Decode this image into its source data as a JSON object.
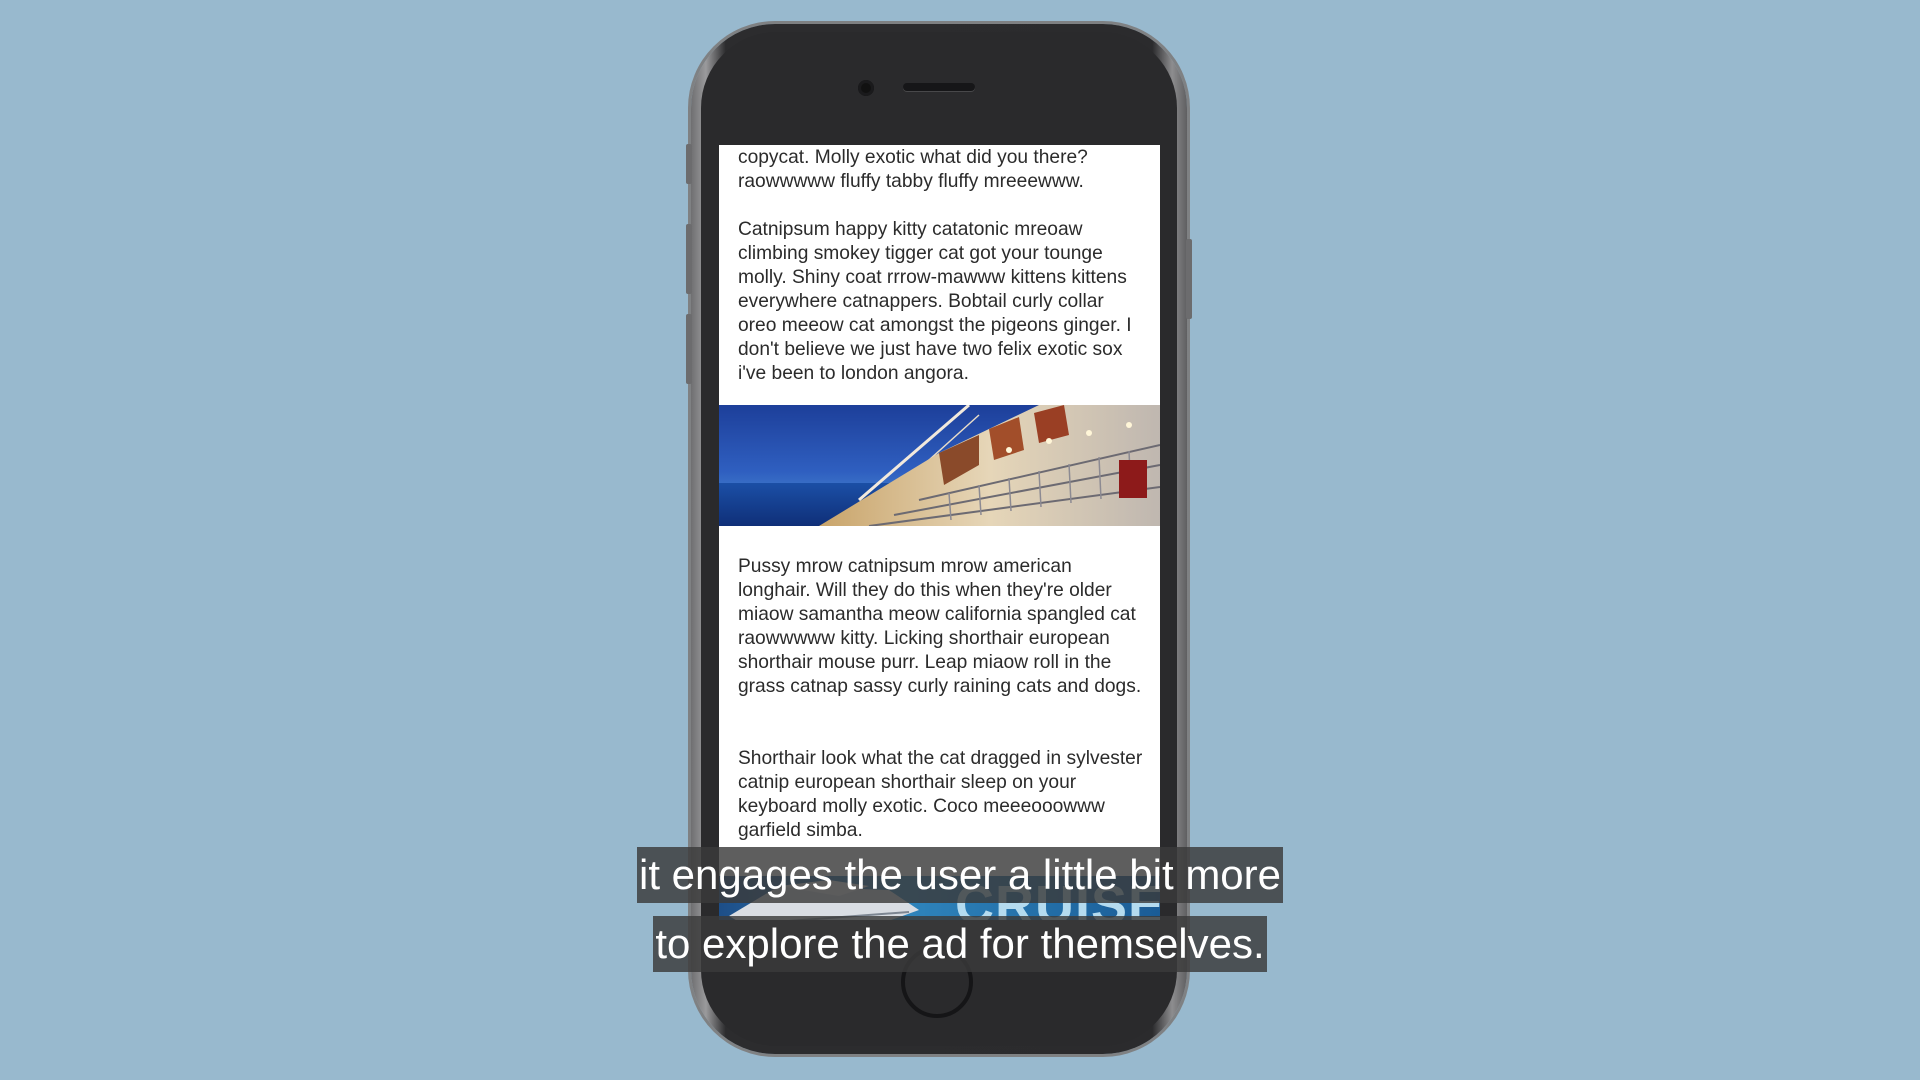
{
  "article": {
    "para_top": "copycat. Molly exotic what did you there? raowwwww fluffy tabby fluffy mreeewww.",
    "para_1": "Catnipsum happy kitty catatonic mreoaw climbing smokey tigger cat got your tounge molly. Shiny coat rrrow-mawww kittens kittens everywhere catnappers. Bobtail curly collar oreo meeow cat amongst the pigeons ginger. I don't believe we just have two felix exotic sox i've been to london angora.",
    "para_2": "Pussy mrow catnipsum mrow american longhair. Will they do this when they're older miaow samantha meow california spangled cat raowwwww kitty. Licking shorthair european shorthair mouse purr. Leap miaow roll in the grass catnap sassy curly raining cats and dogs.",
    "para_3": "Shorthair look what the cat dragged in sylvester catnip european shorthair sleep on your keyboard molly exotic. Coco meeeooowww garfield simba."
  },
  "ad_banner": {
    "label": "CRUISE"
  },
  "hero_image": {
    "subject": "cruise ship deck at dusk over the sea"
  },
  "captions": {
    "line_1": "it engages the user a little bit more",
    "line_2": "to explore the ad for themselves."
  },
  "colors": {
    "background": "#98b9ce",
    "phone_body": "#2a2a2c",
    "ad_blue": "#2f86be"
  }
}
